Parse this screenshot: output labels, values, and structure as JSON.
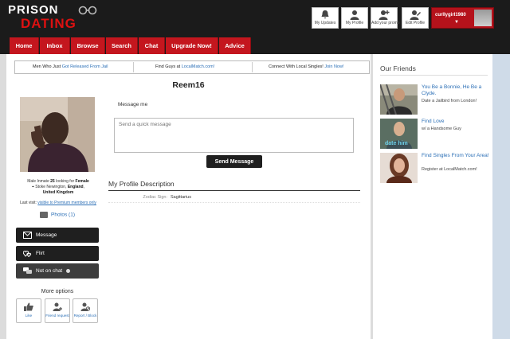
{
  "brand": {
    "line1": "PRISON",
    "line2": "DATING"
  },
  "header_buttons": [
    {
      "label": "My Updates",
      "icon": "bell-icon"
    },
    {
      "label": "My Profile",
      "icon": "person-icon"
    },
    {
      "label": "Add your promo",
      "icon": "person-add-icon"
    },
    {
      "label": "Edit Profile",
      "icon": "person-edit-icon"
    }
  ],
  "user": {
    "username": "curllygirl1980"
  },
  "nav": [
    "Home",
    "Inbox",
    "Browse",
    "Search",
    "Chat",
    "Upgrade Now!",
    "Advice"
  ],
  "promo": [
    {
      "text": "Men Who Just ",
      "link": "Got Released From Jail"
    },
    {
      "text": "Find Guys at ",
      "link": "LocalMatch.com!"
    },
    {
      "text": "Connect With Local Singles! ",
      "link": "Join Now!"
    }
  ],
  "profile": {
    "name": "Reem16",
    "summary_pre": "Male Inmate ",
    "age": "25",
    "summary_mid": " looking for ",
    "seeking": "Female",
    "location_town": "Stoke Newington",
    "location_region": "England",
    "location_country": "United Kingdom",
    "last_visit_label": "Last visit: ",
    "last_visit_value": "visible to Premium members only",
    "photos_label": "Photos (1)",
    "actions": {
      "message": "Message",
      "flirt": "Flirt",
      "chat": "Not on chat"
    },
    "more_options_title": "More options",
    "more_options": [
      "Like",
      "Friend request",
      "Report / Block"
    ]
  },
  "message": {
    "label": "Message me",
    "placeholder": "Send a quick message",
    "send_label": "Send Message"
  },
  "description": {
    "title": "My Profile Description",
    "fields": [
      {
        "key": "Zodiac Sign:",
        "value": "Sagittarius"
      }
    ]
  },
  "sidebar": {
    "title": "Our Friends",
    "friends": [
      {
        "title": "You Be a Bonnie, He Be a Clyde.",
        "desc": "Date a Jailbird from London!"
      },
      {
        "title": "Find Love",
        "desc": "w/ a Handsome Guy",
        "image_caption": "date him"
      },
      {
        "title": "Find Singles From Your Area!",
        "desc": "Register at LocalMatch.com!"
      }
    ]
  },
  "colors": {
    "brand_red": "#c4161e",
    "header_bg": "#1b1b1b",
    "link_blue": "#2b6fb6"
  }
}
